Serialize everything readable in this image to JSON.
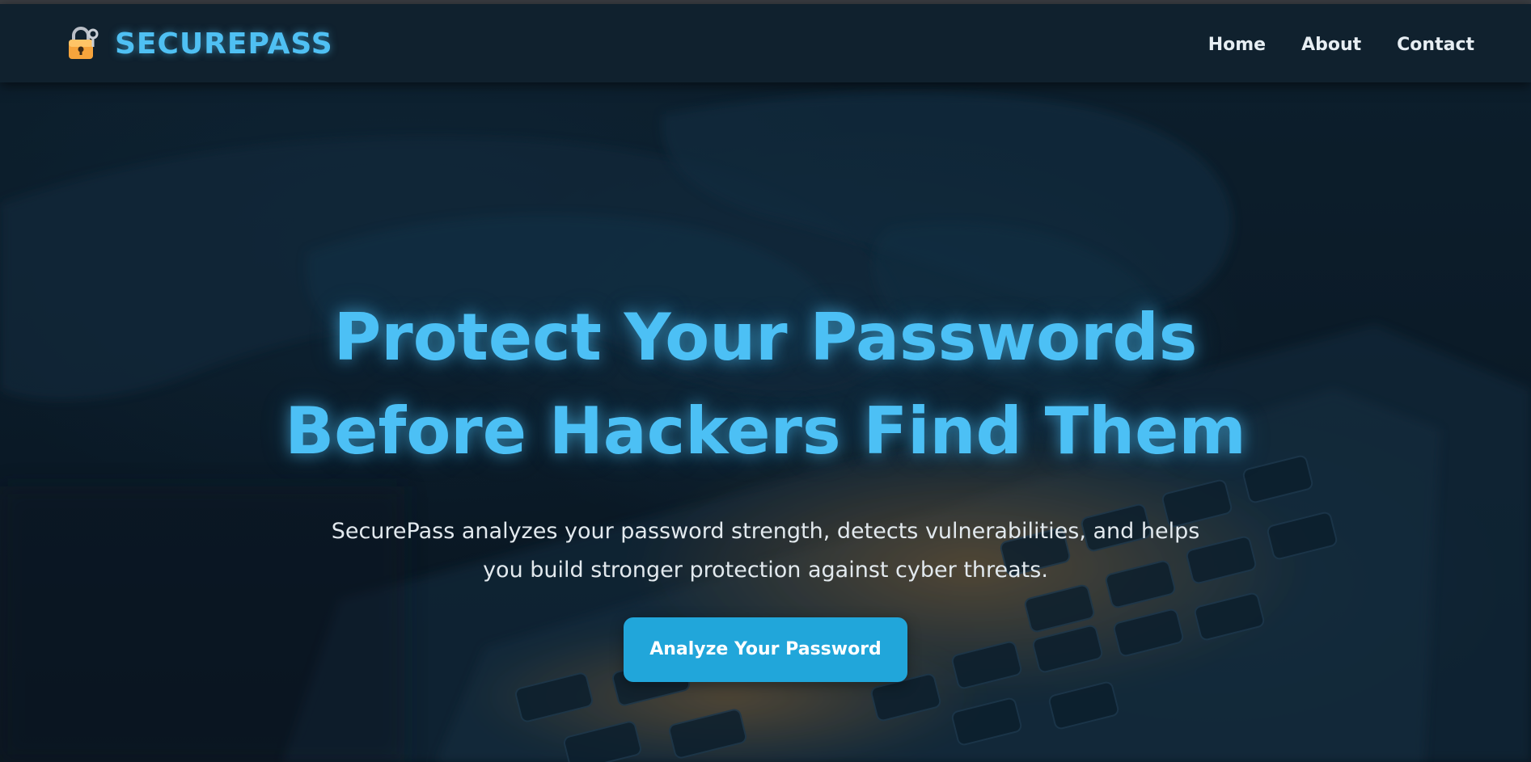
{
  "brand": {
    "name": "SECUREPASS",
    "icon": "locked-with-key-icon"
  },
  "nav": {
    "items": [
      {
        "label": "Home"
      },
      {
        "label": "About"
      },
      {
        "label": "Contact"
      }
    ]
  },
  "hero": {
    "headline_line1": "Protect Your Passwords",
    "headline_line2": "Before Hackers Find Them",
    "subtitle": "SecurePass analyzes your password strength, detects vulnerabilities, and helps you build stronger protection against cyber threats.",
    "cta_label": "Analyze Your Password",
    "background_image": "hands-typing-on-laptop-keyboard"
  },
  "colors": {
    "accent": "#4cc0f5",
    "button": "#21a6da",
    "navbar": "#10212e",
    "background": "#0b1a26"
  }
}
